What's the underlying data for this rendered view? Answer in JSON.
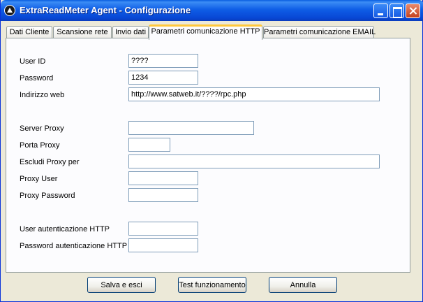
{
  "window": {
    "title": "ExtraReadMeter Agent - Configurazione"
  },
  "tabs": [
    {
      "label": "Dati Cliente"
    },
    {
      "label": "Scansione rete"
    },
    {
      "label": "Invio dati"
    },
    {
      "label": "Parametri comunicazione HTTP",
      "active": true
    },
    {
      "label": "Parametri comunicazione EMAIL"
    }
  ],
  "form": {
    "user_id": {
      "label": "User ID",
      "value": "????"
    },
    "password": {
      "label": "Password",
      "value": "1234"
    },
    "web_address": {
      "label": "Indirizzo web",
      "value": "http://www.satweb.it/????/rpc.php"
    },
    "proxy_server": {
      "label": "Server Proxy",
      "value": ""
    },
    "proxy_port": {
      "label": "Porta Proxy",
      "value": ""
    },
    "proxy_exclude": {
      "label": "Escludi Proxy per",
      "value": ""
    },
    "proxy_user": {
      "label": "Proxy User",
      "value": ""
    },
    "proxy_password": {
      "label": "Proxy Password",
      "value": ""
    },
    "http_auth_user": {
      "label": "User autenticazione HTTP",
      "value": ""
    },
    "http_auth_password": {
      "label": "Password autenticazione HTTP",
      "value": ""
    }
  },
  "buttons": {
    "save": "Salva e esci",
    "test": "Test funzionamento",
    "cancel": "Annulla"
  }
}
